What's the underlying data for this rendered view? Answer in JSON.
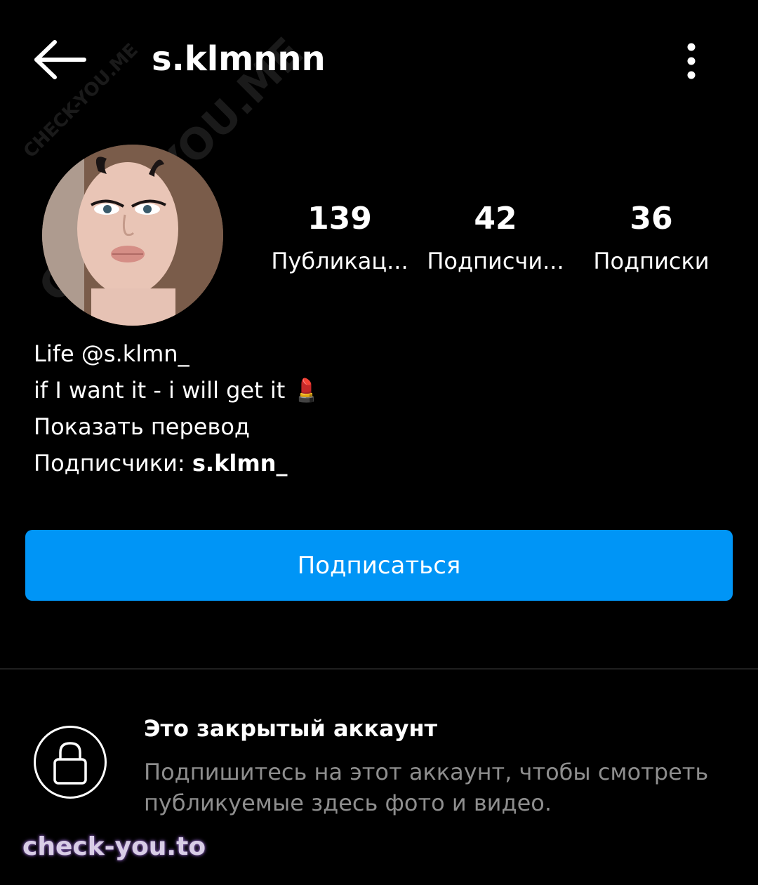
{
  "header": {
    "username": "s.klmnnn"
  },
  "stats": [
    {
      "value": "139",
      "label": "Публикац..."
    },
    {
      "value": "42",
      "label": "Подписчи..."
    },
    {
      "value": "36",
      "label": "Подписки"
    }
  ],
  "bio": {
    "line1": "Life @s.klmn_",
    "line2": "if I want it - i will get it 💄",
    "translate": "Показать перевод",
    "followers_prefix": "Подписчики: ",
    "followers_name": "s.klmn_"
  },
  "follow_button": "Подписаться",
  "private": {
    "title": "Это закрытый аккаунт",
    "description": "Подпишитесь на этот аккаунт, чтобы смотреть публикуемые здесь фото и видео."
  },
  "watermarks": {
    "bottom": "check-you.to",
    "diagonal_small": "CHECK-YOU.ME",
    "diagonal_large": "CHECK-YOU.ME"
  },
  "colors": {
    "background": "#000000",
    "accent": "#0095f6",
    "muted_text": "#8e8e8e"
  },
  "icons": {
    "back": "arrow-left-icon",
    "menu": "more-vertical-icon",
    "lock": "lock-icon"
  }
}
